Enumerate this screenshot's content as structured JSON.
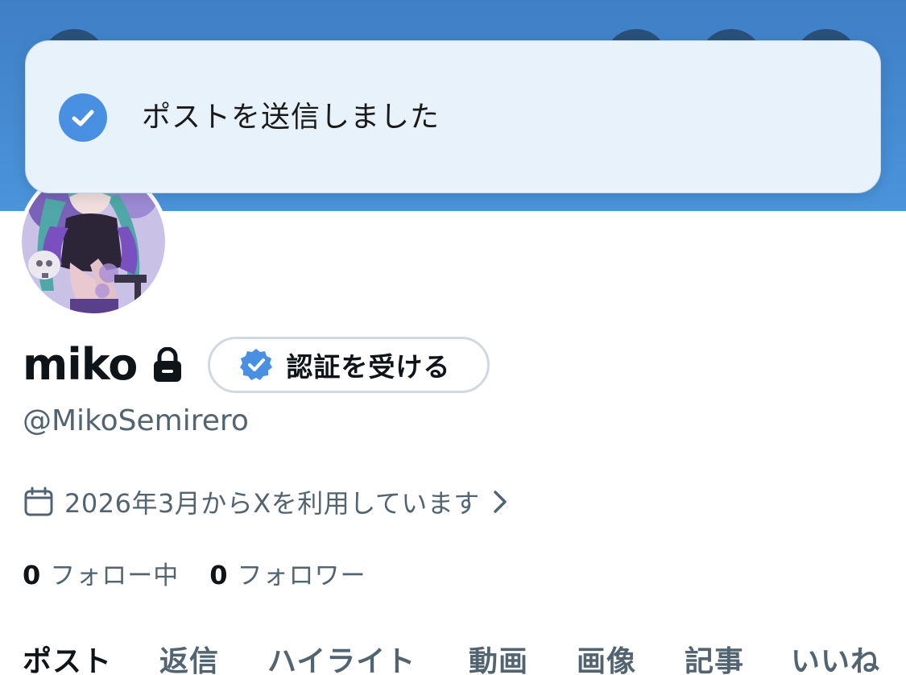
{
  "toast": {
    "message": "ポストを送信しました",
    "icon": "check-circle-icon",
    "accent": "#4a90e2"
  },
  "profile": {
    "display_name": "miko",
    "protected_icon": "lock-icon",
    "verify_button_label": "認証を受ける",
    "verify_icon": "verified-badge-icon",
    "handle": "@MikoSemirero",
    "joined_text": "2026年3月からXを利用しています",
    "following_count": "0",
    "following_label": "フォロー中",
    "followers_count": "0",
    "followers_label": "フォロワー"
  },
  "tabs": [
    {
      "label": "ポスト",
      "active": true
    },
    {
      "label": "返信",
      "active": false
    },
    {
      "label": "ハイライト",
      "active": false
    },
    {
      "label": "動画",
      "active": false
    },
    {
      "label": "画像",
      "active": false
    },
    {
      "label": "記事",
      "active": false
    },
    {
      "label": "いいね",
      "active": false
    }
  ],
  "colors": {
    "banner": "#4a94dc",
    "primary_text": "#0f1419",
    "secondary_text": "#536471",
    "verified_blue": "#4a90e2"
  }
}
